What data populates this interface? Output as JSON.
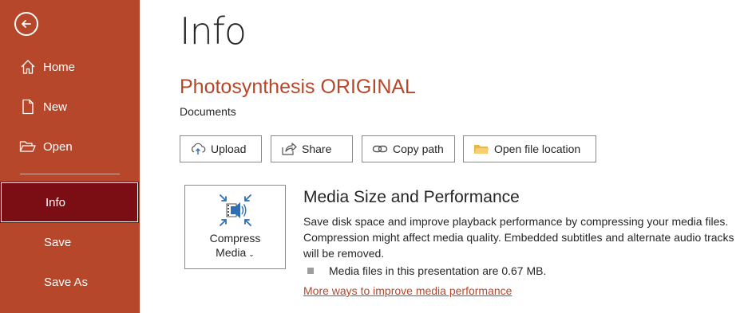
{
  "sidebar": {
    "items": [
      {
        "label": "Home",
        "icon": "home-icon"
      },
      {
        "label": "New",
        "icon": "new-document-icon"
      },
      {
        "label": "Open",
        "icon": "folder-open-icon"
      },
      {
        "label": "Info"
      },
      {
        "label": "Save"
      },
      {
        "label": "Save As"
      }
    ],
    "selected": "Info"
  },
  "main": {
    "page_title": "Info",
    "document_title": "Photosynthesis ORIGINAL",
    "document_location": "Documents",
    "actions": [
      {
        "label": "Upload",
        "icon": "upload-icon"
      },
      {
        "label": "Share",
        "icon": "share-icon"
      },
      {
        "label": "Copy path",
        "icon": "link-icon"
      },
      {
        "label": "Open file location",
        "icon": "folder-icon"
      }
    ],
    "media": {
      "button_line1": "Compress",
      "button_line2": "Media",
      "title": "Media Size and Performance",
      "description": "Save disk space and improve playback performance by compressing your media files. Compression might affect media quality. Embedded subtitles and alternate audio tracks will be removed.",
      "bullet": "Media files in this presentation are 0.67 MB.",
      "link": "More ways to improve media performance"
    }
  },
  "colors": {
    "sidebar_bg": "#b7472a",
    "selected_bg": "#7a0e14",
    "accent": "#b7472a",
    "icon_blue": "#2f6eb5"
  }
}
